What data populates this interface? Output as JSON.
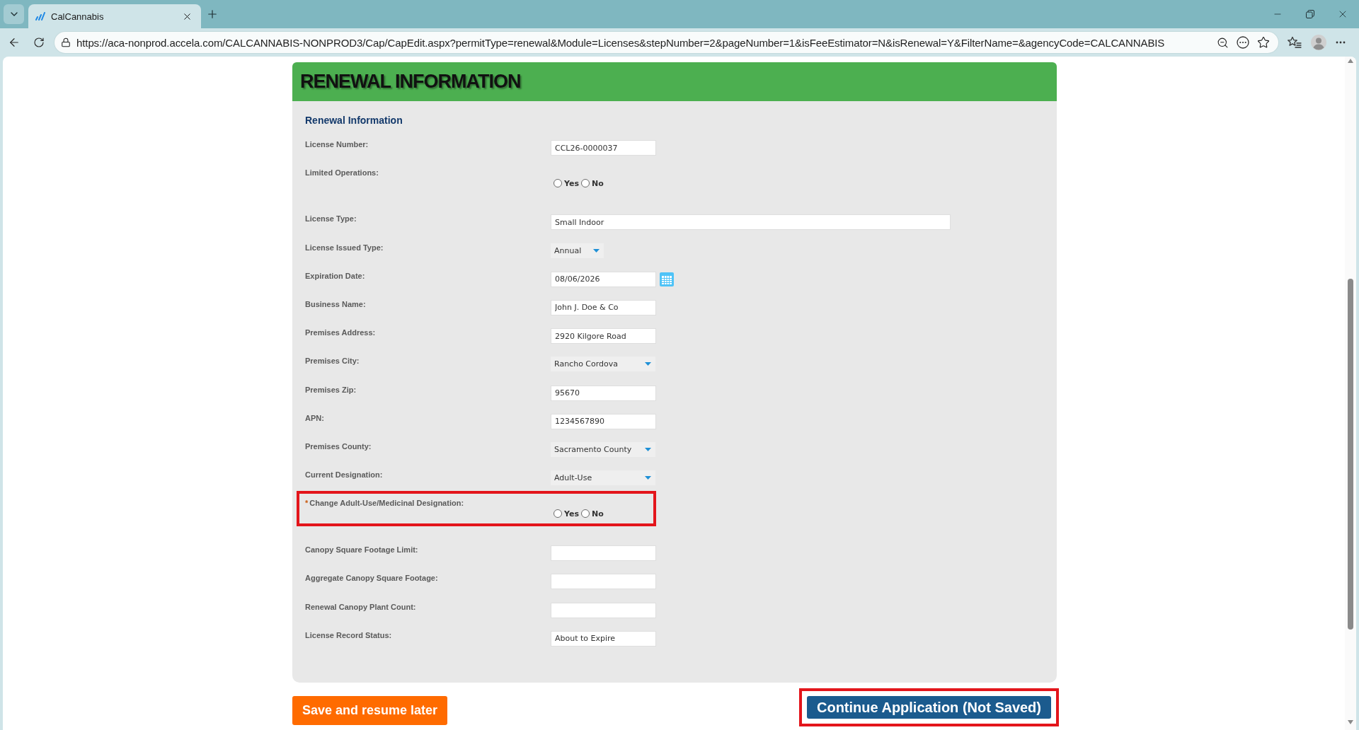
{
  "browser": {
    "tab": {
      "title": "CalCannabis"
    },
    "address_bar": {
      "url": "https://aca-nonprod.accela.com/CALCANNABIS-NONPROD3/Cap/CapEdit.aspx?permitType=renewal&Module=Licenses&stepNumber=2&pageNumber=1&isFeeEstimator=N&isRenewal=Y&FilterName=&agencyCode=CALCANNABIS"
    }
  },
  "form": {
    "title": "RENEWAL INFORMATION",
    "section_title": "Renewal Information",
    "fields": [
      {
        "kind": "text",
        "label": "License Number:",
        "value": "CCL26-0000037",
        "highlighted": false
      },
      {
        "kind": "radio",
        "label": "Limited Operations:",
        "highlighted": false,
        "options": [
          {
            "label": "Yes",
            "selected": false
          },
          {
            "label": "No",
            "selected": false
          }
        ]
      },
      {
        "kind": "text",
        "label": "License Type:",
        "value": "Small Indoor",
        "highlighted": false
      },
      {
        "kind": "select",
        "label": "License Issued Type:",
        "value": "Annual",
        "highlighted": false
      },
      {
        "kind": "date",
        "label": "Expiration Date:",
        "value": "08/06/2026",
        "highlighted": false
      },
      {
        "kind": "text",
        "label": "Business Name:",
        "value": "John J. Doe & Co",
        "highlighted": false
      },
      {
        "kind": "text",
        "label": "Premises Address:",
        "value": "2920 Kilgore Road",
        "highlighted": false
      },
      {
        "kind": "select",
        "label": "Premises City:",
        "value": "Rancho Cordova",
        "highlighted": false
      },
      {
        "kind": "text",
        "label": "Premises Zip:",
        "value": "95670",
        "highlighted": false
      },
      {
        "kind": "text",
        "label": "APN:",
        "value": "1234567890",
        "highlighted": false
      },
      {
        "kind": "select",
        "label": "Premises County:",
        "value": "Sacramento County",
        "highlighted": false
      },
      {
        "kind": "select",
        "label": "Current Designation:",
        "value": "Adult-Use",
        "highlighted": false
      },
      {
        "kind": "radio",
        "label": "Change Adult-Use/Medicinal Designation:",
        "required_mark": "*",
        "highlighted": true,
        "options": [
          {
            "label": "Yes",
            "selected": false
          },
          {
            "label": "No",
            "selected": false
          }
        ]
      },
      {
        "kind": "text",
        "label": "Canopy Square Footage Limit:",
        "highlighted": false
      },
      {
        "kind": "text",
        "label": "Aggregate Canopy Square Footage:",
        "highlighted": false
      },
      {
        "kind": "text",
        "label": "Renewal Canopy Plant Count:",
        "highlighted": false
      },
      {
        "kind": "text",
        "label": "License Record Status:",
        "value": "About to Expire",
        "highlighted": false
      }
    ]
  },
  "buttons": [
    {
      "kind": "accent",
      "label": "Save and resume later",
      "highlighted": false
    },
    {
      "kind": "primary",
      "label": "Continue Application (Not Saved)",
      "highlighted": true
    }
  ]
}
